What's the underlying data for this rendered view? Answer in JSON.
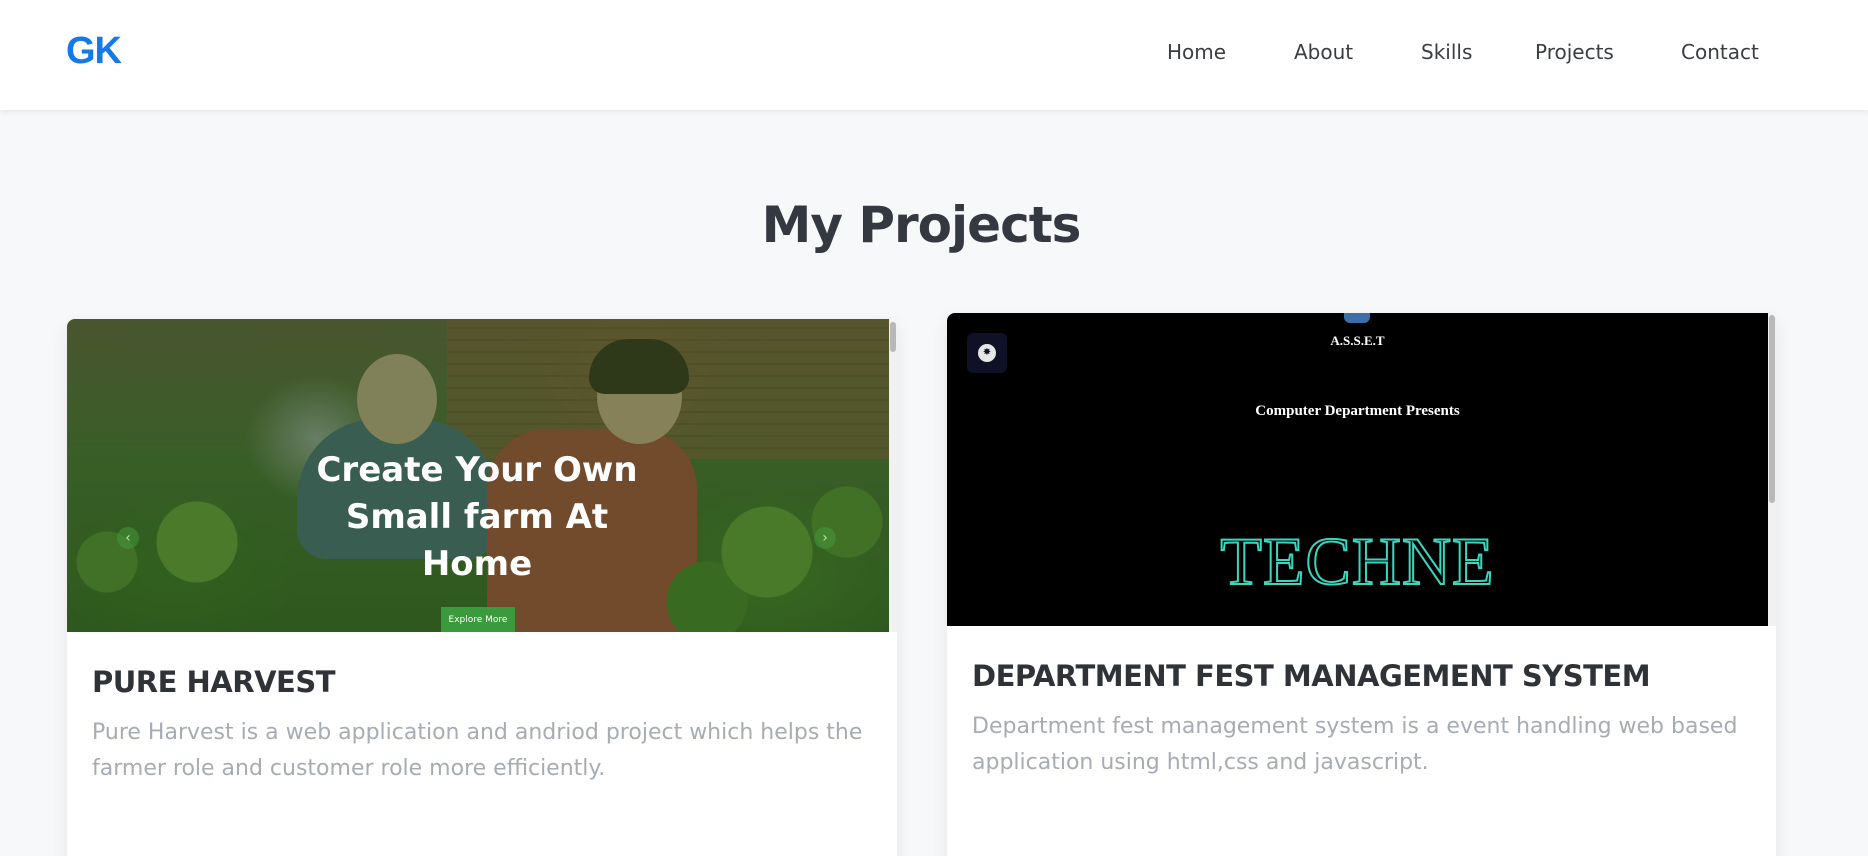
{
  "header": {
    "logo": "GK",
    "nav": [
      "Home",
      "About",
      "Skills",
      "Projects",
      "Contact"
    ]
  },
  "main": {
    "section_title": "My Projects",
    "projects": [
      {
        "title": "PURE HARVEST",
        "description": "Pure Harvest is a web application and andriod project which helps the farmer role and customer role more efficiently.",
        "preview": {
          "hero_text": "Create Your Own Small farm At Home",
          "button_label": "Explore More",
          "prev_icon": "chevron-left-icon",
          "next_icon": "chevron-right-icon"
        }
      },
      {
        "title": "DEPARTMENT FEST MANAGEMENT SYSTEM",
        "description": "Department fest management system is a event handling web based application using html,css and javascript.",
        "preview": {
          "org": "A.S.S.E.T",
          "presents": "Computer Department Presents",
          "event_name": "TECHNE",
          "badge_icon": "brain-icon"
        }
      }
    ]
  },
  "colors": {
    "brand": "#1479ea",
    "accent_green": "#3a9a3c",
    "techne_outline": "#3bd6c0"
  }
}
